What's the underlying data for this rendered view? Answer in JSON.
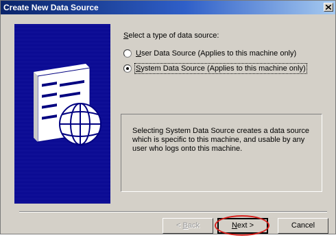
{
  "window": {
    "title": "Create New Data Source",
    "close_icon": "close-icon"
  },
  "main": {
    "prompt": {
      "mnemonic": "S",
      "rest": "elect a type of data source:"
    },
    "options": [
      {
        "mnemonic": "U",
        "rest": "ser Data Source (Applies to this machine only)",
        "selected": false
      },
      {
        "mnemonic": "S",
        "rest": "ystem Data Source (Applies to this machine only)",
        "selected": true
      }
    ],
    "description": "Selecting System Data Source creates a data source which is specific to this machine, and usable by any user who logs onto this machine."
  },
  "buttons": {
    "back": {
      "prefix": "< ",
      "mnemonic": "B",
      "rest": "ack",
      "enabled": false
    },
    "next": {
      "mnemonic": "N",
      "rest": "ext >",
      "enabled": true,
      "is_default": true
    },
    "cancel": {
      "label": "Cancel",
      "enabled": true
    }
  },
  "annotation": {
    "color": "#d8201c",
    "target": "next-button"
  },
  "colors": {
    "title_start": "#0a246a",
    "title_end": "#a6caf0",
    "dialog_bg": "#d4d0c8",
    "art_bg": "#00008a"
  }
}
